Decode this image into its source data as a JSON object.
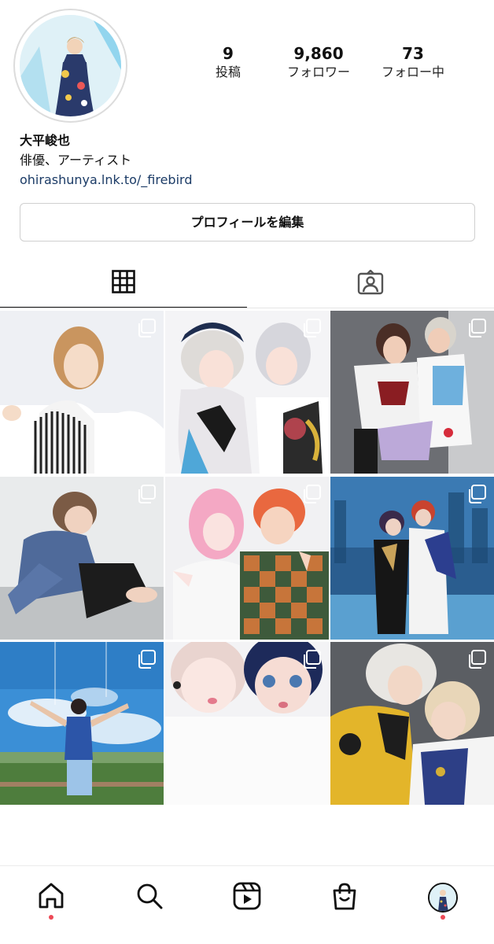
{
  "profile": {
    "name": "大平峻也",
    "bio": "俳優、アーティスト",
    "link": "ohirashunya.lnk.to/_firebird",
    "edit_label": "プロフィールを編集"
  },
  "stats": [
    {
      "value": "9",
      "label": "投稿"
    },
    {
      "value": "9,860",
      "label": "フォロワー"
    },
    {
      "value": "73",
      "label": "フォロー中"
    }
  ],
  "tabs": [
    {
      "icon": "grid-icon",
      "active": true
    },
    {
      "icon": "tagged-icon",
      "active": false
    }
  ],
  "posts": [
    {
      "subject": "portrait with striped shirt",
      "multi": true
    },
    {
      "subject": "two costumed performers",
      "multi": true
    },
    {
      "subject": "two costumed performers backstage",
      "multi": true
    },
    {
      "subject": "person on sofa in satin shirt",
      "multi": true
    },
    {
      "subject": "two people peace sign",
      "multi": true
    },
    {
      "subject": "costumed pair in blue castle scene",
      "multi": true
    },
    {
      "subject": "person arms outstretched in landscape",
      "multi": true
    },
    {
      "subject": "two faces close-up",
      "multi": true
    },
    {
      "subject": "costumed pair gold and white",
      "multi": true
    }
  ],
  "bottom_nav": [
    {
      "icon": "home-icon",
      "notification": true
    },
    {
      "icon": "search-icon",
      "notification": false
    },
    {
      "icon": "reels-icon",
      "notification": false
    },
    {
      "icon": "shop-icon",
      "notification": false
    },
    {
      "icon": "profile-avatar",
      "notification": true
    }
  ],
  "colors": {
    "link": "#1b3b66",
    "notification_dot": "#ed4956",
    "border": "#cfcfcf"
  }
}
